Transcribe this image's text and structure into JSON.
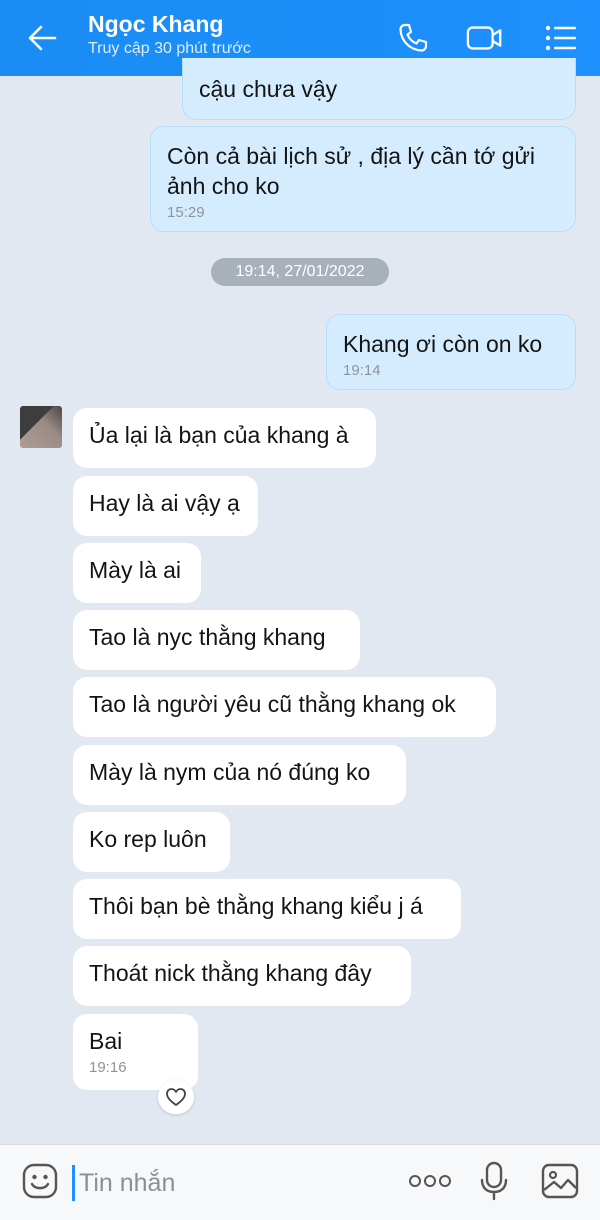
{
  "header": {
    "contact_name": "Ngọc Khang",
    "status": "Truy cập 30 phút trước",
    "icons": [
      "back-arrow-icon",
      "phone-icon",
      "video-call-icon",
      "menu-list-icon"
    ]
  },
  "messages": {
    "out_1": {
      "text": "cậu chưa vậy"
    },
    "out_2": {
      "text": "Còn cả bài lịch sử , địa lý cần tớ gửi ảnh cho ko",
      "time": "15:29"
    },
    "date_separator": "19:14, 27/01/2022",
    "out_3": {
      "text": "Khang ơi còn on ko",
      "time": "19:14"
    },
    "in": [
      {
        "text": "Ủa lại là bạn của khang à"
      },
      {
        "text": "Hay là ai vậy ạ"
      },
      {
        "text": "Mày là ai"
      },
      {
        "text": "Tao là nyc thằng khang"
      },
      {
        "text": "Tao là người yêu cũ thằng khang ok"
      },
      {
        "text": "Mày là nym của nó đúng ko"
      },
      {
        "text": "Ko rep luôn"
      },
      {
        "text": "Thôi bạn bè thằng khang kiểu j á"
      },
      {
        "text": "Thoát nick thằng khang đây"
      },
      {
        "text": "Bai",
        "time": "19:16"
      }
    ]
  },
  "composer": {
    "placeholder": "Tin nhắn",
    "icons": [
      "emoji-icon",
      "more-options-icon",
      "microphone-icon",
      "image-icon"
    ]
  },
  "colors": {
    "header": "#1e90ff",
    "outgoing_bubble": "#d5ecff",
    "incoming_bubble": "#ffffff",
    "background": "#e2e8f1"
  }
}
